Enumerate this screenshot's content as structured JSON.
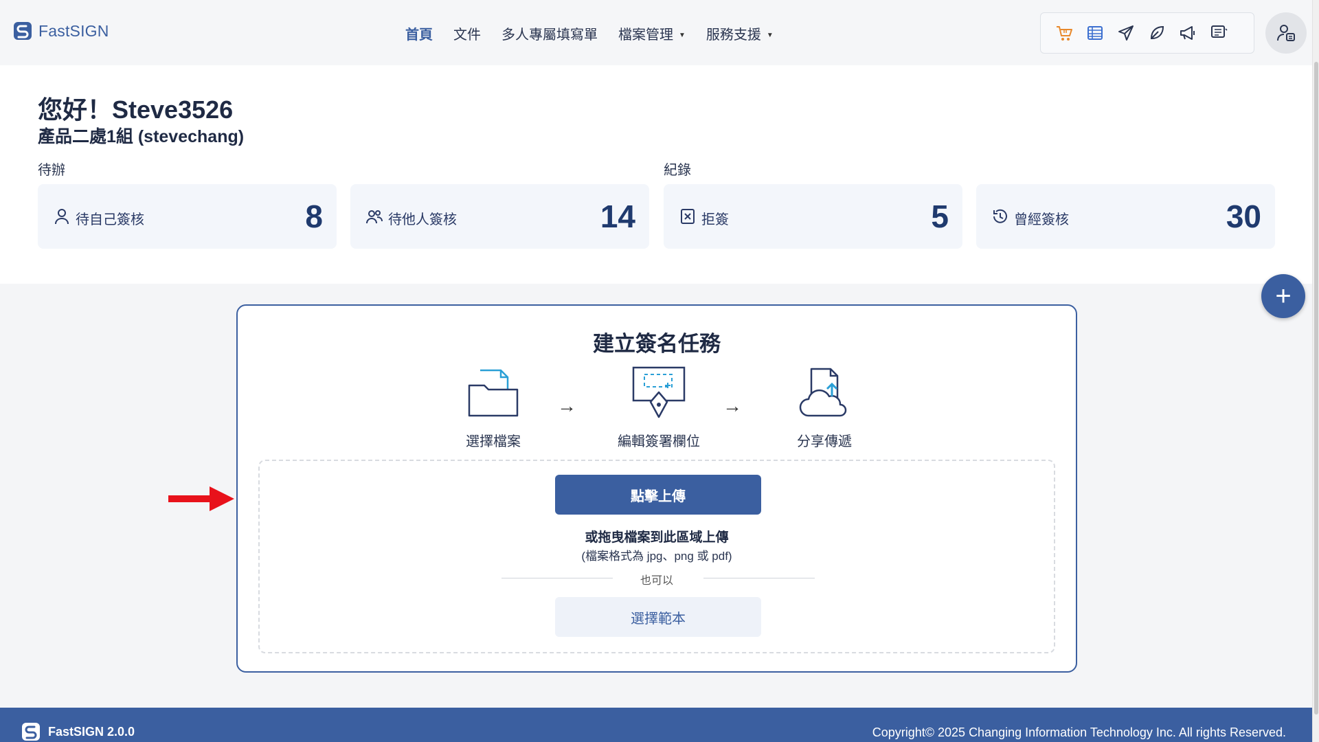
{
  "brand": {
    "name": "FastSIGN",
    "accent": "#3b5fa0"
  },
  "nav": {
    "items": [
      {
        "label": "首頁",
        "active": true,
        "dropdown": false
      },
      {
        "label": "文件",
        "active": false,
        "dropdown": false
      },
      {
        "label": "多人專屬填寫單",
        "active": false,
        "dropdown": false
      },
      {
        "label": "檔案管理",
        "active": false,
        "dropdown": true
      },
      {
        "label": "服務支援",
        "active": false,
        "dropdown": true
      }
    ]
  },
  "toolbar": {
    "icons": [
      "cart-icon",
      "table-icon",
      "send-icon",
      "leaf-icon",
      "megaphone-icon",
      "notes-icon"
    ]
  },
  "welcome": {
    "greeting": "您好！Steve3526",
    "subname": "產品二處1組 (stevechang)",
    "todo_label": "待辦",
    "record_label": "紀錄",
    "cards": [
      {
        "label": "待自己簽核",
        "count": "8",
        "icon": "user-icon"
      },
      {
        "label": "待他人簽核",
        "count": "14",
        "icon": "users-icon"
      },
      {
        "label": "拒簽",
        "count": "5",
        "icon": "reject-icon"
      },
      {
        "label": "曾經簽核",
        "count": "30",
        "icon": "history-icon"
      }
    ]
  },
  "task": {
    "title": "建立簽名任務",
    "steps": [
      {
        "label": "選擇檔案",
        "icon": "folder-icon"
      },
      {
        "label": "編輯簽署欄位",
        "icon": "pen-field-icon"
      },
      {
        "label": "分享傳遞",
        "icon": "cloud-upload-icon"
      }
    ],
    "arrow": "→",
    "upload_label": "點擊上傳",
    "drag_text": "或拖曳檔案到此區域上傳",
    "format_text": "(檔案格式為 jpg、png 或 pdf)",
    "or_text": "也可以",
    "template_label": "選擇範本"
  },
  "fab": {
    "label": "+"
  },
  "footer": {
    "version": "FastSIGN 2.0.0",
    "copyright": "Copyright© 2025 Changing Information Technology Inc. All rights Reserved."
  }
}
